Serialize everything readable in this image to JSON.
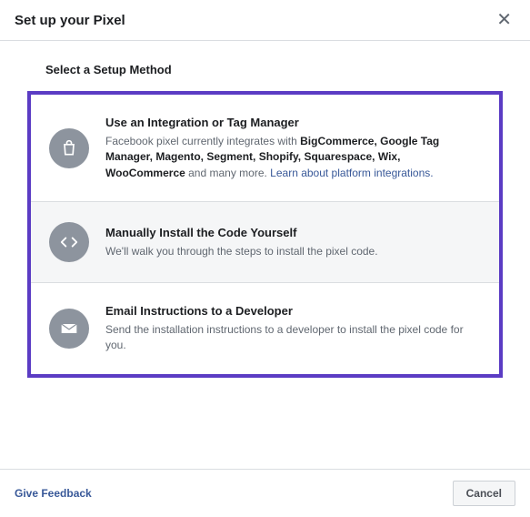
{
  "header": {
    "title": "Set up your Pixel"
  },
  "subtitle": "Select a Setup Method",
  "options": [
    {
      "title": "Use an Integration or Tag Manager",
      "desc_prefix": "Facebook pixel currently integrates with ",
      "integrations_csv": "BigCommerce, Google Tag Manager, Magento, Segment, Shopify, Squarespace, Wix, WooCommerce",
      "desc_suffix": " and many more. ",
      "link_text": "Learn about platform integrations."
    },
    {
      "title": "Manually Install the Code Yourself",
      "desc": "We'll walk you through the steps to install the pixel code."
    },
    {
      "title": "Email Instructions to a Developer",
      "desc": "Send the installation instructions to a developer to install the pixel code for you."
    }
  ],
  "footer": {
    "feedback": "Give Feedback",
    "cancel": "Cancel"
  }
}
